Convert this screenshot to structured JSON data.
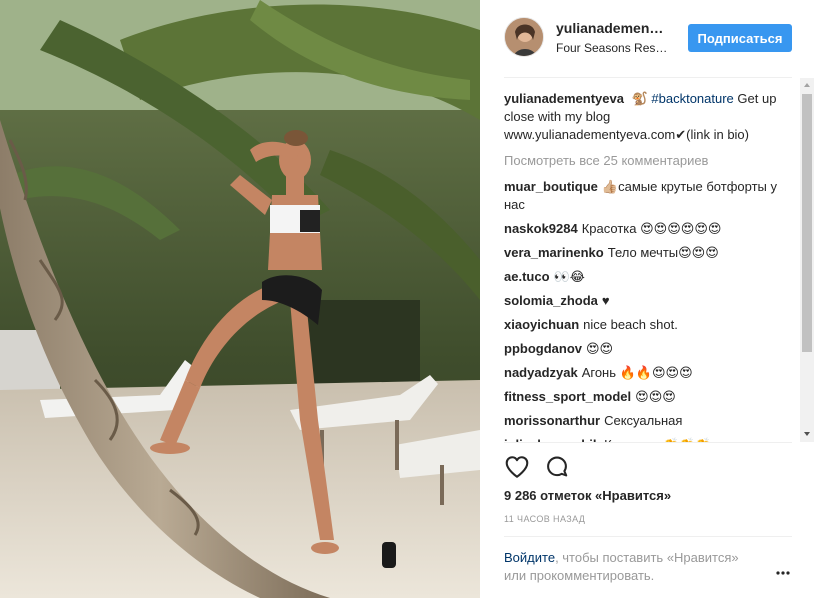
{
  "post": {
    "username": "yulianadementyeva",
    "location": "Four Seasons Resort",
    "follow_label": "Подписаться"
  },
  "caption": {
    "username": "yulianadementyeva",
    "emoji": "🐒",
    "hashtag": "#backtonature",
    "text": "Get up close with my blog www.yulianadementyeva.com✔(link in bio)"
  },
  "view_all_comments": "Посмотреть все 25 комментариев",
  "comments": [
    {
      "username": "muar_boutique",
      "text": "👍🏼самые крутые ботфорты у нас"
    },
    {
      "username": "naskok9284",
      "text": "Красотка 😍😍😍😍😍😍"
    },
    {
      "username": "vera_marinenko",
      "text": "Тело мечты😍😍😍"
    },
    {
      "username": "ae.tuco",
      "text": "👀😂"
    },
    {
      "username": "solomia_zhoda",
      "text": "♥"
    },
    {
      "username": "xiaoyichuan",
      "text": "nice beach shot."
    },
    {
      "username": "ppbogdanov",
      "text": "😍😍"
    },
    {
      "username": "nadyadzyak",
      "text": "Агонь 🔥🔥😍😍😍"
    },
    {
      "username": "fitness_sport_model",
      "text": "😍😍😍"
    },
    {
      "username": "morissonarthur",
      "text": "Сексуальная"
    },
    {
      "username": "julia_kuznechik",
      "text": "Красотка 👏👏👏"
    }
  ],
  "icons": {
    "like": "heart-icon",
    "comment": "comment-bubble-icon",
    "more": "more-options-icon"
  },
  "likes_text": "9 286 отметок «Нравится»",
  "time_text": "11 часов назад",
  "login_prompt": {
    "link": "Войдите",
    "rest": ", чтобы поставить «Нравится» или прокомментировать."
  },
  "colors": {
    "accent": "#3897f0",
    "link": "#003569",
    "muted": "#999999",
    "text": "#262626"
  }
}
